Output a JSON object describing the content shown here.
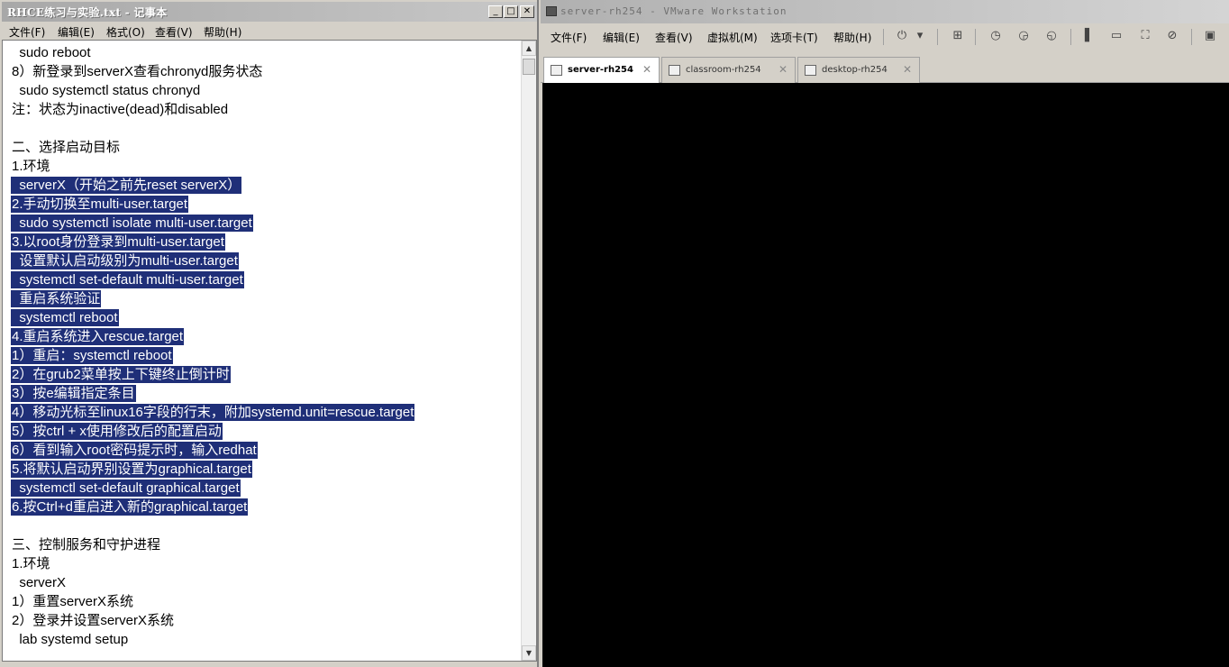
{
  "notepad": {
    "title": "RHCE练习与实验.txt - 记事本",
    "controls": {
      "minimize": "_",
      "maximize": "□",
      "close": "✕"
    },
    "menu": [
      "文件(F)",
      "编辑(E)",
      "格式(O)",
      "查看(V)",
      "帮助(H)"
    ],
    "lines": [
      {
        "text": "  sudo reboot",
        "selected": false
      },
      {
        "text": "8）新登录到serverX查看chronyd服务状态",
        "selected": false
      },
      {
        "text": "  sudo systemctl status chronyd",
        "selected": false
      },
      {
        "text": "注：状态为inactive(dead)和disabled",
        "selected": false
      },
      {
        "text": "",
        "selected": false
      },
      {
        "text": "二、选择启动目标",
        "selected": false
      },
      {
        "text": "1.环境",
        "selected": false
      },
      {
        "text": "  serverX（开始之前先reset serverX）",
        "selected": true
      },
      {
        "text": "2.手动切换至multi-user.target",
        "selected": true
      },
      {
        "text": "  sudo systemctl isolate multi-user.target",
        "selected": true
      },
      {
        "text": "3.以root身份登录到multi-user.target",
        "selected": true
      },
      {
        "text": "  设置默认启动级别为multi-user.target",
        "selected": true
      },
      {
        "text": "  systemctl set-default multi-user.target",
        "selected": true
      },
      {
        "text": "  重启系统验证",
        "selected": true
      },
      {
        "text": "  systemctl reboot",
        "selected": true
      },
      {
        "text": "4.重启系统进入rescue.target",
        "selected": true
      },
      {
        "text": "1）重启：systemctl reboot",
        "selected": true
      },
      {
        "text": "2）在grub2菜单按上下键终止倒计时",
        "selected": true
      },
      {
        "text": "3）按e编辑指定条目",
        "selected": true
      },
      {
        "text": "4）移动光标至linux16字段的行末，附加systemd.unit=rescue.target",
        "selected": true
      },
      {
        "text": "5）按ctrl + x使用修改后的配置启动",
        "selected": true
      },
      {
        "text": "6）看到输入root密码提示时，输入redhat",
        "selected": true
      },
      {
        "text": "5.将默认启动界别设置为graphical.target",
        "selected": true
      },
      {
        "text": "  systemctl set-default graphical.target",
        "selected": true
      },
      {
        "text": "6.按Ctrl+d重启进入新的graphical.target",
        "selected": true
      },
      {
        "text": "",
        "selected": false
      },
      {
        "text": "三、控制服务和守护进程",
        "selected": false
      },
      {
        "text": "1.环境",
        "selected": false
      },
      {
        "text": "  serverX",
        "selected": false
      },
      {
        "text": "1）重置serverX系统",
        "selected": false
      },
      {
        "text": "2）登录并设置serverX系统",
        "selected": false
      },
      {
        "text": "  lab systemd setup",
        "selected": false
      }
    ]
  },
  "vmware": {
    "title": "server-rh254 - VMware Workstation",
    "menu": [
      "文件(F)",
      "编辑(E)",
      "查看(V)",
      "虚拟机(M)",
      "选项卡(T)",
      "帮助(H)"
    ],
    "tabs": [
      {
        "label": "server-rh254",
        "active": true
      },
      {
        "label": "classroom-rh254",
        "active": false
      },
      {
        "label": "desktop-rh254",
        "active": false
      }
    ],
    "tab_close": "✕",
    "screen_color": "#000000"
  },
  "colors": {
    "selection": "#1f2f78",
    "selection_text": "#ffffff"
  }
}
